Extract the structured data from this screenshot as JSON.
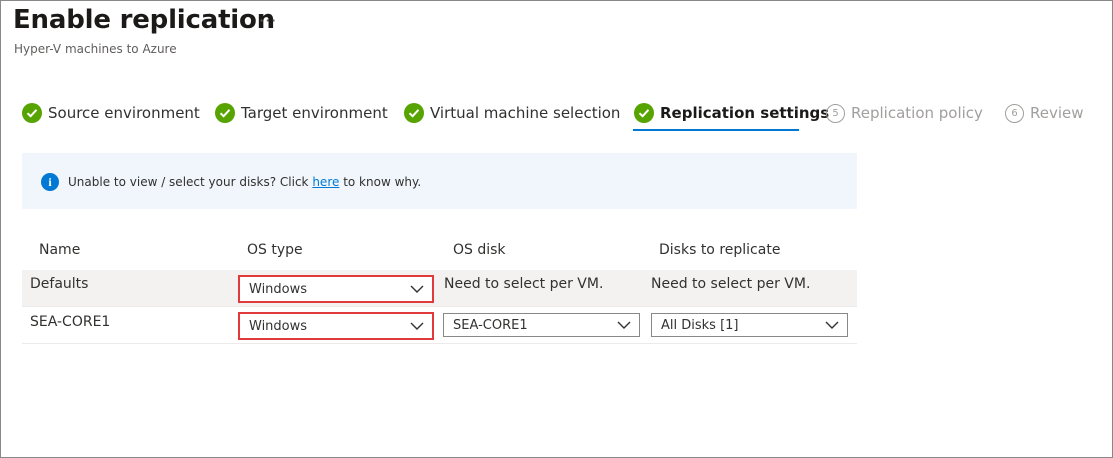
{
  "header": {
    "title": "Enable replication",
    "more_label": "···",
    "subtitle": "Hyper-V machines to Azure"
  },
  "steps": [
    {
      "label": "Source environment",
      "status": "complete"
    },
    {
      "label": "Target environment",
      "status": "complete"
    },
    {
      "label": "Virtual machine selection",
      "status": "complete"
    },
    {
      "label": "Replication settings",
      "status": "active"
    },
    {
      "label": "Replication policy",
      "status": "pending",
      "number": "5"
    },
    {
      "label": "Review",
      "status": "pending",
      "number": "6"
    }
  ],
  "info": {
    "text_before": "Unable to view / select your disks? Click ",
    "link": "here",
    "text_after": " to know why."
  },
  "table": {
    "headers": [
      "Name",
      "OS type",
      "OS disk",
      "Disks to replicate"
    ],
    "rows": [
      {
        "name": "Defaults",
        "os_type": "Windows",
        "os_disk": "Need to select per VM.",
        "disks": "Need to select per VM."
      },
      {
        "name": "SEA-CORE1",
        "os_type": "Windows",
        "os_disk": "SEA-CORE1",
        "disks": "All Disks [1]"
      }
    ]
  },
  "colors": {
    "success": "#57a300",
    "accent": "#0078d4",
    "highlight": "#e03a3a"
  }
}
